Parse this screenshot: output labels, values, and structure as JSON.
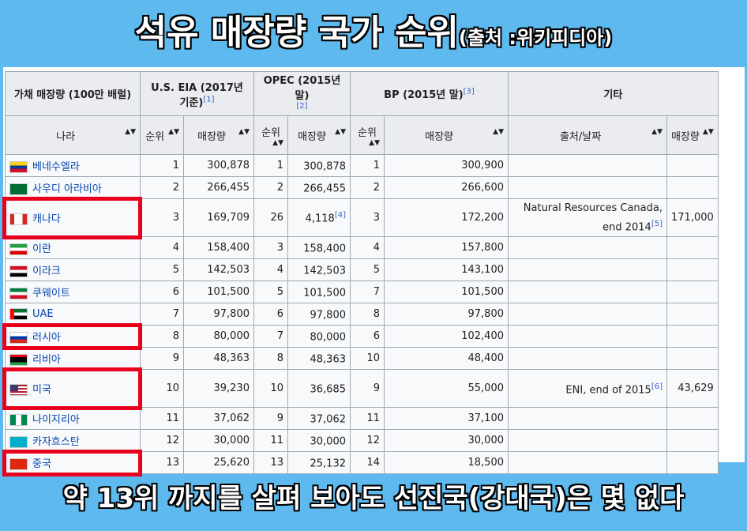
{
  "title": {
    "main": "석유 매장량 국가 순위",
    "source": "(출처 :위키피디아)"
  },
  "table": {
    "header1": {
      "col1": "가채 매장량 (100만 배럴)",
      "eia": "U.S. EIA (2017년 기준)",
      "eia_ref": "[1]",
      "opec": "OPEC (2015년 말)",
      "opec_ref": "[2]",
      "bp": "BP (2015년 말)",
      "bp_ref": "[3]",
      "other": "기타"
    },
    "header2": {
      "country": "나라",
      "rank": "순위",
      "reserves": "매장량",
      "opec_rank": "순위",
      "opec_reserves": "매장량",
      "bp_rank": "순위",
      "bp_reserves": "매장량",
      "source_date": "출처/날짜",
      "other_reserves": "매장량"
    },
    "sort_icon": "▲▼",
    "rows": [
      {
        "country": "베네수엘라",
        "flag": "ve",
        "eia_rank": "1",
        "eia": "300,878",
        "opec_rank": "1",
        "opec": "300,878",
        "opec_ref": "",
        "bp_rank": "1",
        "bp": "300,900",
        "src": "",
        "src_ref": "",
        "other": ""
      },
      {
        "country": "사우디 아라비아",
        "flag": "sa",
        "eia_rank": "2",
        "eia": "266,455",
        "opec_rank": "2",
        "opec": "266,455",
        "opec_ref": "",
        "bp_rank": "2",
        "bp": "266,600",
        "src": "",
        "src_ref": "",
        "other": ""
      },
      {
        "country": "캐나다",
        "flag": "ca",
        "eia_rank": "3",
        "eia": "169,709",
        "opec_rank": "26",
        "opec": "4,118",
        "opec_ref": "[4]",
        "bp_rank": "3",
        "bp": "172,200",
        "src": "Natural Resources Canada, end 2014",
        "src_ref": "[5]",
        "other": "171,000"
      },
      {
        "country": "이란",
        "flag": "ir",
        "eia_rank": "4",
        "eia": "158,400",
        "opec_rank": "3",
        "opec": "158,400",
        "opec_ref": "",
        "bp_rank": "4",
        "bp": "157,800",
        "src": "",
        "src_ref": "",
        "other": ""
      },
      {
        "country": "이라크",
        "flag": "iq",
        "eia_rank": "5",
        "eia": "142,503",
        "opec_rank": "4",
        "opec": "142,503",
        "opec_ref": "",
        "bp_rank": "5",
        "bp": "143,100",
        "src": "",
        "src_ref": "",
        "other": ""
      },
      {
        "country": "쿠웨이트",
        "flag": "kw",
        "eia_rank": "6",
        "eia": "101,500",
        "opec_rank": "5",
        "opec": "101,500",
        "opec_ref": "",
        "bp_rank": "7",
        "bp": "101,500",
        "src": "",
        "src_ref": "",
        "other": ""
      },
      {
        "country": "UAE",
        "flag": "ae",
        "eia_rank": "7",
        "eia": "97,800",
        "opec_rank": "6",
        "opec": "97,800",
        "opec_ref": "",
        "bp_rank": "8",
        "bp": "97,800",
        "src": "",
        "src_ref": "",
        "other": ""
      },
      {
        "country": "러시아",
        "flag": "ru",
        "eia_rank": "8",
        "eia": "80,000",
        "opec_rank": "7",
        "opec": "80,000",
        "opec_ref": "",
        "bp_rank": "6",
        "bp": "102,400",
        "src": "",
        "src_ref": "",
        "other": ""
      },
      {
        "country": "리비아",
        "flag": "ly",
        "eia_rank": "9",
        "eia": "48,363",
        "opec_rank": "8",
        "opec": "48,363",
        "opec_ref": "",
        "bp_rank": "10",
        "bp": "48,400",
        "src": "",
        "src_ref": "",
        "other": ""
      },
      {
        "country": "미국",
        "flag": "us",
        "eia_rank": "10",
        "eia": "39,230",
        "opec_rank": "10",
        "opec": "36,685",
        "opec_ref": "",
        "bp_rank": "9",
        "bp": "55,000",
        "src": "ENI, end of 2015",
        "src_ref": "[6]",
        "other": "43,629"
      },
      {
        "country": "나이지리아",
        "flag": "ng",
        "eia_rank": "11",
        "eia": "37,062",
        "opec_rank": "9",
        "opec": "37,062",
        "opec_ref": "",
        "bp_rank": "11",
        "bp": "37,100",
        "src": "",
        "src_ref": "",
        "other": ""
      },
      {
        "country": "카자흐스탄",
        "flag": "kz",
        "eia_rank": "12",
        "eia": "30,000",
        "opec_rank": "11",
        "opec": "30,000",
        "opec_ref": "",
        "bp_rank": "12",
        "bp": "30,000",
        "src": "",
        "src_ref": "",
        "other": ""
      },
      {
        "country": "중국",
        "flag": "cn",
        "eia_rank": "13",
        "eia": "25,620",
        "opec_rank": "13",
        "opec": "25,132",
        "opec_ref": "",
        "bp_rank": "14",
        "bp": "18,500",
        "src": "",
        "src_ref": "",
        "other": ""
      }
    ]
  },
  "highlighted_countries": [
    "캐나다",
    "러시아",
    "미국",
    "중국"
  ],
  "highlight_color": "#e8001c",
  "background_color": "#5db9ee",
  "caption": "약 13위 까지를 살펴 보아도 선진국(강대국)은 몇 없다"
}
